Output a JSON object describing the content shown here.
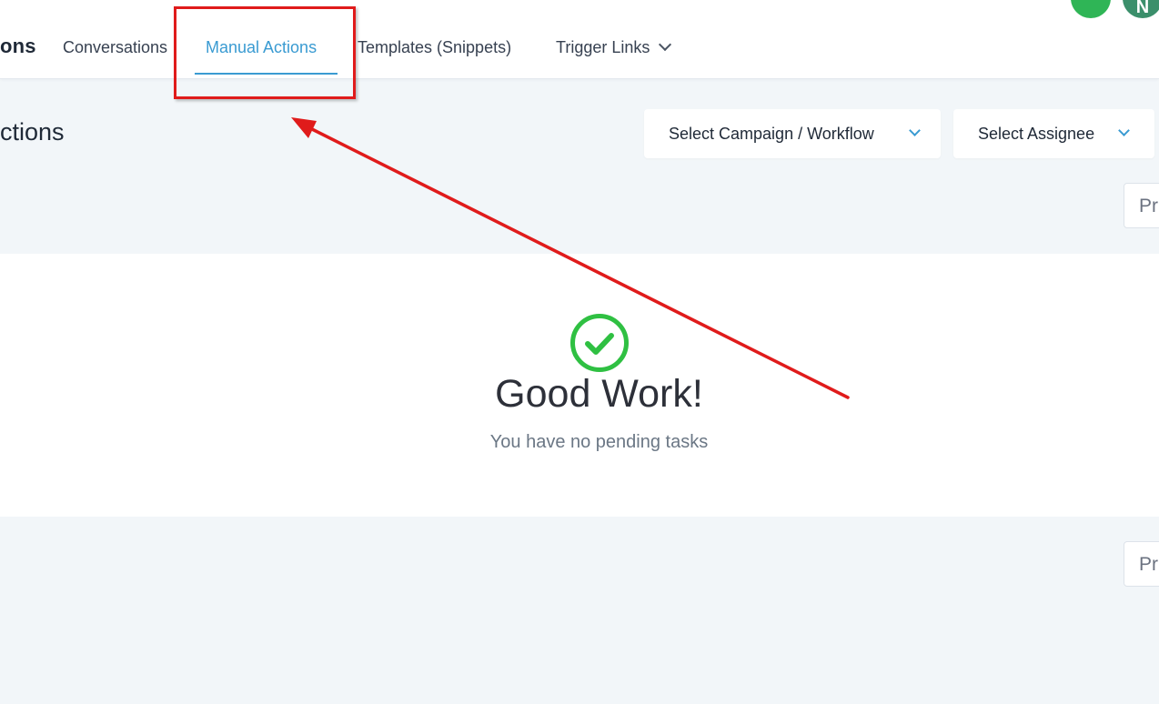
{
  "nav": {
    "app_title": "ons",
    "items": [
      {
        "label": "Conversations",
        "active": false
      },
      {
        "label": "Manual Actions",
        "active": true
      },
      {
        "label": "Templates (Snippets)",
        "active": false
      },
      {
        "label": "Trigger Links",
        "active": false
      }
    ],
    "avatars": [
      {
        "icon": "phone-icon",
        "letter": ""
      },
      {
        "icon": "user-avatar",
        "letter": "N"
      }
    ]
  },
  "page": {
    "title": "ctions",
    "filters": {
      "campaign": "Select Campaign / Workflow",
      "assignee": "Select Assignee"
    },
    "pager_top": "Pr",
    "pager_bottom": "Pr"
  },
  "empty_state": {
    "icon": "check-circle-icon",
    "title": "Good Work!",
    "subtitle": "You have no pending tasks"
  },
  "colors": {
    "accent": "#3a9bd2",
    "success": "#2fc042",
    "annotation": "#e01b1b",
    "background": "#f2f6f9"
  }
}
